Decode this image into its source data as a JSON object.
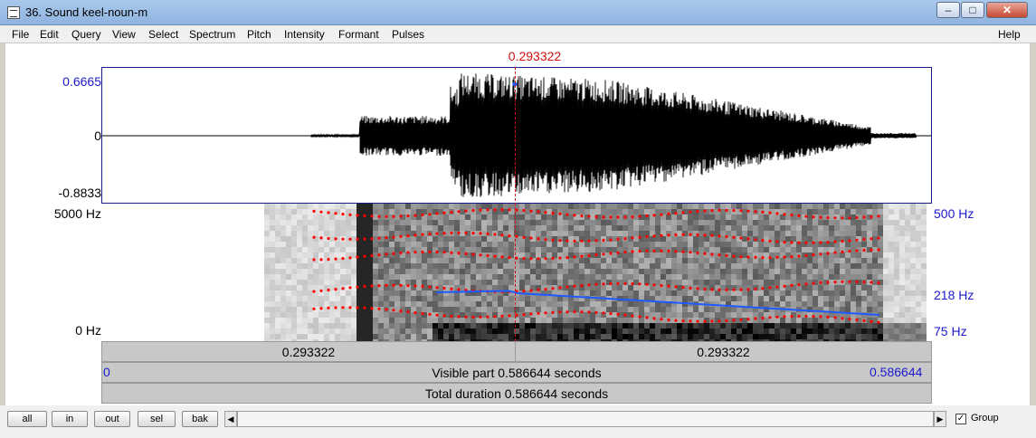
{
  "window": {
    "title": "36. Sound keel-noun-m"
  },
  "menu": [
    "File",
    "Edit",
    "Query",
    "View",
    "Select",
    "Spectrum",
    "Pitch",
    "Intensity",
    "Formant",
    "Pulses"
  ],
  "help": "Help",
  "cursor": {
    "time": "0.293322"
  },
  "waveform": {
    "ymax": "0.6665",
    "yzero": "0",
    "ymin": "-0.8833"
  },
  "spectrogram": {
    "top": "5000 Hz",
    "bottom": "0 Hz"
  },
  "pitch": {
    "top": "500 Hz",
    "mid": "218 Hz",
    "bottom": "75 Hz"
  },
  "colors": {
    "cursor": "#d01010",
    "pitch": "#1a1ad0",
    "formant": "#ff0000",
    "pitch_line": "#1e5aff"
  },
  "segments": {
    "left": "0.293322",
    "right": "0.293322"
  },
  "visible": {
    "start": "0",
    "label": "Visible part 0.586644 seconds",
    "end": "0.586644"
  },
  "total": {
    "label": "Total duration 0.586644 seconds"
  },
  "buttons": {
    "all": "all",
    "in": "in",
    "out": "out",
    "sel": "sel",
    "bak": "bak"
  },
  "group": {
    "label": "Group",
    "checked": true
  }
}
